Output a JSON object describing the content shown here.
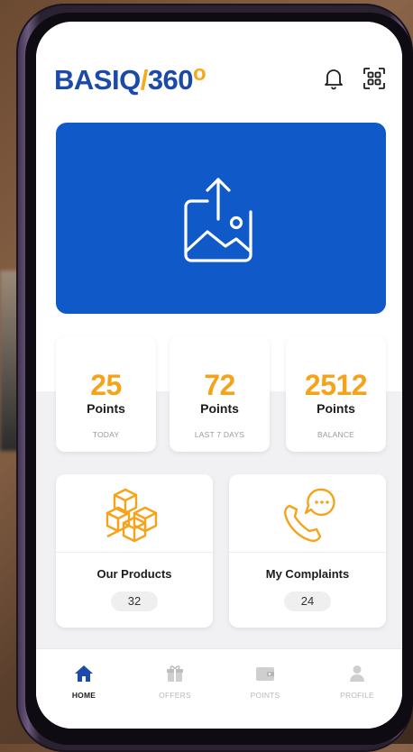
{
  "app": {
    "logo": {
      "text_main": "BASIQ",
      "text_slash": "/",
      "text_num": "360",
      "text_deg": "o"
    },
    "colors": {
      "brand_blue": "#1b4aa8",
      "banner_blue": "#0f5ac8",
      "accent_orange": "#f5a31a"
    },
    "header_icons": [
      "bell-icon",
      "qr-scan-icon"
    ]
  },
  "banner": {
    "icon": "image-upload-icon"
  },
  "stats": [
    {
      "value": "25",
      "unit": "Points",
      "label": "TODAY"
    },
    {
      "value": "72",
      "unit": "Points",
      "label": "LAST 7 DAYS"
    },
    {
      "value": "2512",
      "unit": "Points",
      "label": "BALANCE"
    }
  ],
  "features": [
    {
      "title": "Our Products",
      "count": "32",
      "icon": "boxes-icon"
    },
    {
      "title": "My Complaints",
      "count": "24",
      "icon": "phone-chat-icon"
    }
  ],
  "nav": [
    {
      "label": "HOME",
      "icon": "home-icon",
      "active": true
    },
    {
      "label": "OFFERS",
      "icon": "gift-icon",
      "active": false
    },
    {
      "label": "POINTS",
      "icon": "wallet-icon",
      "active": false
    },
    {
      "label": "PROFILE",
      "icon": "user-icon",
      "active": false
    }
  ]
}
